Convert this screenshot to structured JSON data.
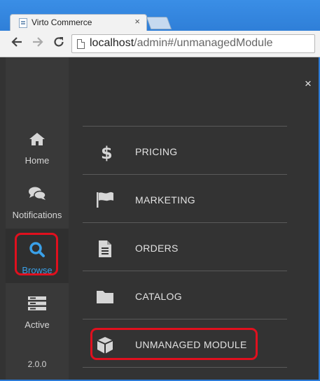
{
  "browser": {
    "tab_title": "Virto Commerce",
    "tab_close": "×",
    "url_host": "localhost",
    "url_path": "/admin#/unmanagedModule"
  },
  "sidebar": {
    "items": [
      {
        "label": "Home",
        "icon": "home-icon"
      },
      {
        "label": "Notifications",
        "icon": "chat-bubbles-icon"
      },
      {
        "label": "Browse",
        "icon": "search-icon",
        "active": true
      },
      {
        "label": "Active",
        "icon": "stacked-servers-icon"
      }
    ],
    "version": "2.0.0"
  },
  "panel": {
    "close": "×",
    "menu": [
      {
        "label": "PRICING",
        "icon": "dollar-icon"
      },
      {
        "label": "MARKETING",
        "icon": "flag-icon"
      },
      {
        "label": "ORDERS",
        "icon": "document-icon"
      },
      {
        "label": "CATALOG",
        "icon": "folder-icon"
      },
      {
        "label": "UNMANAGED MODULE",
        "icon": "cube-icon"
      }
    ]
  },
  "colors": {
    "active_accent": "#3aa0e8",
    "highlight": "#e0101e",
    "panel_bg": "#333333",
    "sidebar_bg": "#393939"
  }
}
